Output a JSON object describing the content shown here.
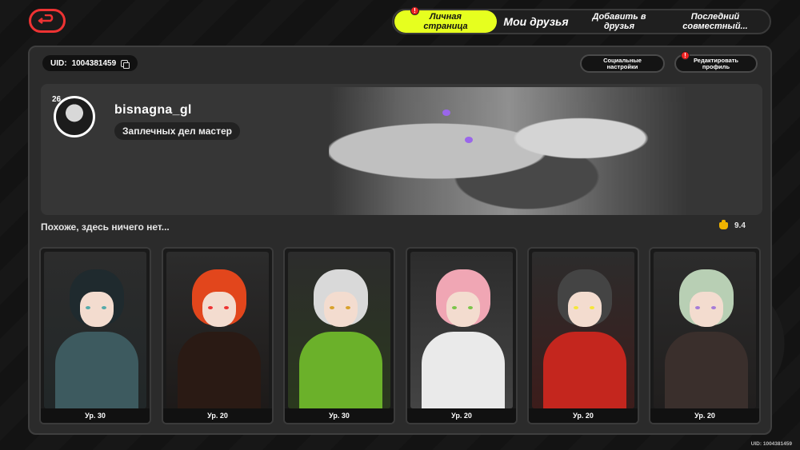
{
  "tabs": [
    {
      "label": "Личная\nстраница",
      "active": true,
      "badge": "!"
    },
    {
      "label": "Мои друзья",
      "active": false
    },
    {
      "label": "Добавить в\nдрузья",
      "active": false
    },
    {
      "label": "Последний\nсовместный...",
      "active": false
    }
  ],
  "uid": {
    "label": "UID:",
    "value": "1004381459"
  },
  "buttons": {
    "social": "Социальные\nнастройки",
    "edit": "Редактировать\nпрофиль",
    "edit_badge": "!"
  },
  "profile": {
    "level": "26",
    "username": "bisnagna_gl",
    "title": "Заплечных дел мастер",
    "signature": "Похоже, здесь ничего нет...",
    "achievement_score": "9.4"
  },
  "characters": [
    {
      "level": "Ур. 30",
      "hair": "#1f2a2e",
      "body": "#3d5a5f",
      "eye": "#5aa"
    },
    {
      "level": "Ур. 20",
      "hair": "#e2461c",
      "body": "#2a1a14",
      "eye": "#e33"
    },
    {
      "level": "Ур. 30",
      "hair": "#d9d9d9",
      "body": "#6bb12a",
      "eye": "#d8a22c"
    },
    {
      "level": "Ур. 20",
      "hair": "#f0a6b4",
      "body": "#eaeaea",
      "eye": "#7bc54a"
    },
    {
      "level": "Ур. 20",
      "hair": "#444444",
      "body": "#c4261e",
      "eye": "#f5e63a"
    },
    {
      "level": "Ур. 20",
      "hair": "#b8cfb4",
      "body": "#3a2f2c",
      "eye": "#a57bd8"
    }
  ],
  "footer_uid": "UID: 1004381459",
  "colors": {
    "accent": "#e6ff1f",
    "back": "#ee3333",
    "badge": "#e22222",
    "trophy": "#f0b400"
  }
}
